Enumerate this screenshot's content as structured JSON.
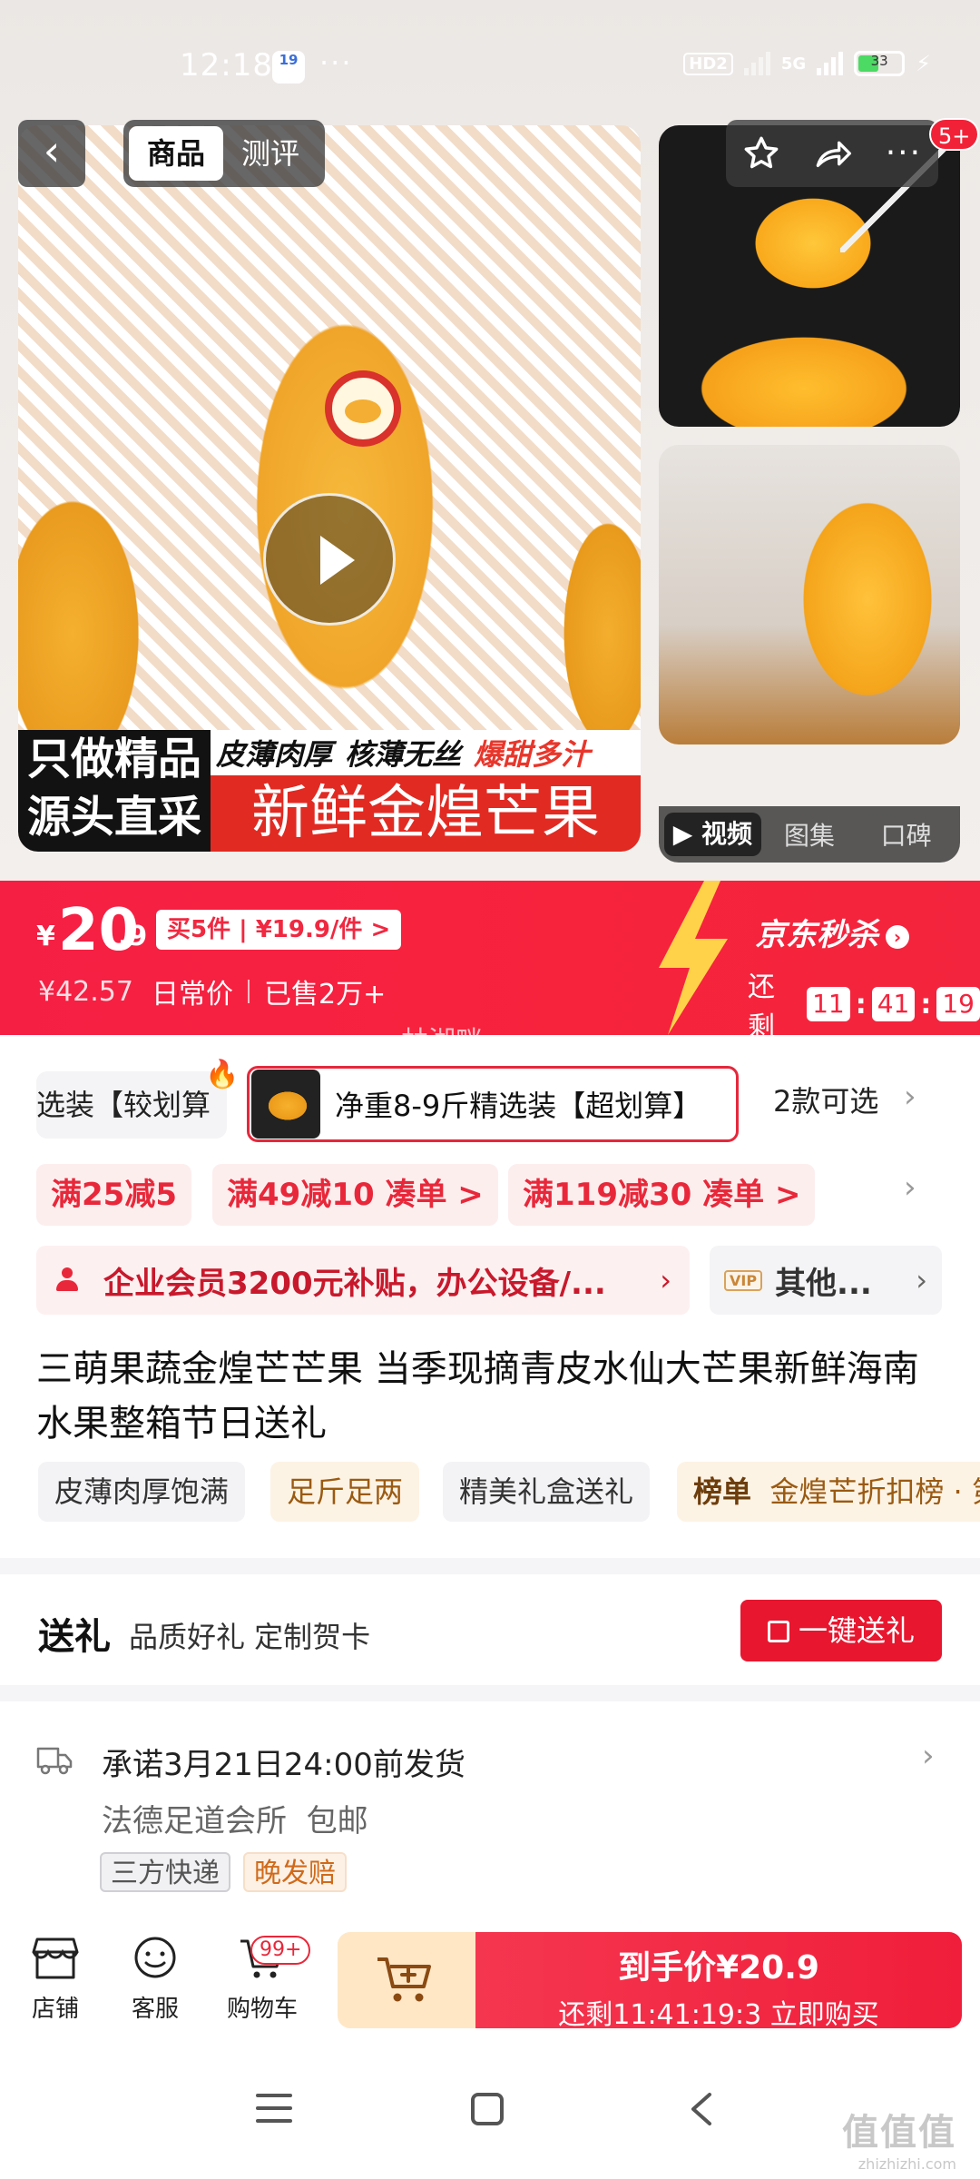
{
  "status_bar": {
    "time": "12:18",
    "notification_badge": "19",
    "dots": "···",
    "hd_label": "HD2",
    "network": "5G",
    "battery": "33"
  },
  "header": {
    "tabs": [
      {
        "label": "商品",
        "active": true
      },
      {
        "label": "测评",
        "active": false
      }
    ],
    "message_badge": "5+"
  },
  "gallery": {
    "promo_left_line1": "只做精品",
    "promo_left_line2": "源头直采",
    "promo_top_1": "皮薄肉厚",
    "promo_top_2": "核薄无丝",
    "promo_top_3": "爆甜多汁",
    "promo_bottom": "新鲜金煌芒果",
    "media_tabs": [
      "▶ 视频",
      "图集",
      "口碑"
    ]
  },
  "price": {
    "currency": "¥",
    "integer": "20",
    "decimal": ".9",
    "bulk_tag": "买5件 | ¥19.9/件 >",
    "original_price": "¥42.57",
    "original_label": "日常价",
    "sold": "已售2万+",
    "flash_label": "京东秒杀",
    "remaining_label": "还剩",
    "countdown": {
      "h": "11",
      "m": "41",
      "s": "19"
    },
    "accent": "#f3243d"
  },
  "watermark_text": "林湖畔",
  "variants": {
    "option1": "选装【较划算",
    "option2": "净重8-9斤精选装【超划算】",
    "more": "2款可选"
  },
  "coupons": [
    "满25减5",
    "满49减10  凑单 >",
    "满119减30  凑单 >"
  ],
  "member": {
    "text": "企业会员3200元补贴，办公设备/...",
    "other_vip": "VIP",
    "other_text": "其他..."
  },
  "product_title": "三萌果蔬金煌芒芒果 当季现摘青皮水仙大芒果新鲜海南水果整箱节日送礼",
  "tags": [
    {
      "label": "皮薄肉厚饱满",
      "style": "gray"
    },
    {
      "label": "足斤足两",
      "style": "gold"
    },
    {
      "label": "精美礼盒送礼",
      "style": "gray"
    },
    {
      "prefix": "榜单",
      "label": "金煌芒折扣榜 · 第",
      "style": "gold"
    }
  ],
  "gift": {
    "title": "送礼",
    "subtitle": "品质好礼  定制贺卡",
    "button": "一键送礼"
  },
  "shipping": {
    "promise": "承诺3月21日24:00前发货",
    "location": "法德足道会所",
    "free_shipping": "包邮",
    "tag1": "三方快递",
    "tag2": "晚发赔"
  },
  "bottom_bar": {
    "shop": "店铺",
    "service": "客服",
    "cart": "购物车",
    "cart_badge": "99+",
    "buy_line1": "到手价¥20.9",
    "buy_line2": "还剩11:41:19:3  立即购买"
  },
  "site_watermark": {
    "line1": "值值值",
    "line2": "zhizhizhi.com"
  }
}
